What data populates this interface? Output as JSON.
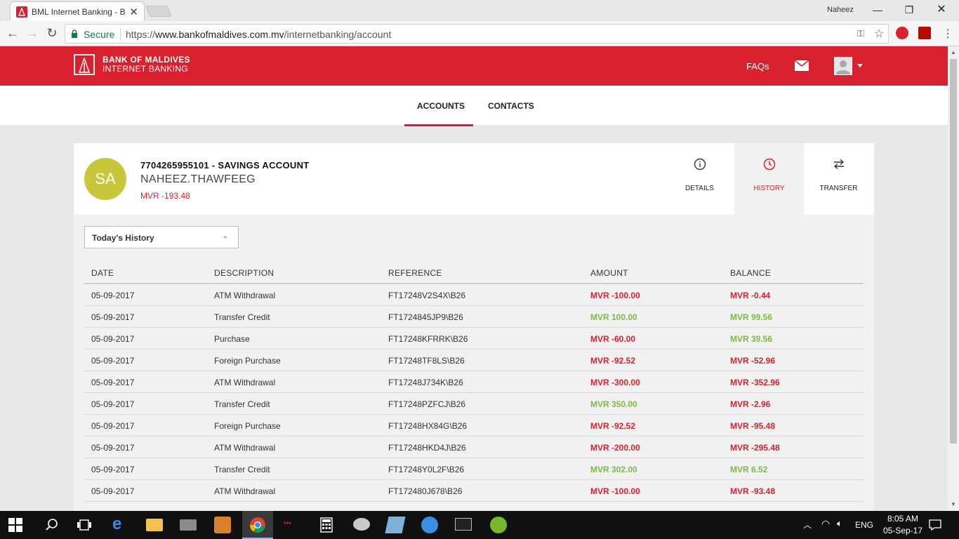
{
  "browser": {
    "tab_title": "BML Internet Banking - B",
    "user_name": "Naheez",
    "secure_label": "Secure",
    "url_prefix": "https://",
    "url_host": "www.bankofmaldives.com.mv",
    "url_path": "/internetbanking/account"
  },
  "header": {
    "brand_line1": "BANK OF MALDIVES",
    "brand_line2": "INTERNET BANKING",
    "faqs_label": "FAQs"
  },
  "nav": {
    "tabs": [
      {
        "label": "ACCOUNTS",
        "active": true
      },
      {
        "label": "CONTACTS",
        "active": false
      }
    ]
  },
  "account": {
    "initials": "SA",
    "title": "7704265955101 - SAVINGS ACCOUNT",
    "holder": "NAHEEZ.THAWFEEG",
    "balance": "MVR -193.48",
    "actions": [
      {
        "label": "DETAILS",
        "icon": "info-icon"
      },
      {
        "label": "HISTORY",
        "icon": "clock-icon",
        "active": true
      },
      {
        "label": "TRANSFER",
        "icon": "transfer-arrows-icon"
      }
    ]
  },
  "history": {
    "filter_selected": "Today's History",
    "columns": [
      "DATE",
      "DESCRIPTION",
      "REFERENCE",
      "AMOUNT",
      "BALANCE"
    ],
    "rows": [
      {
        "date": "05-09-2017",
        "description": "ATM Withdrawal",
        "reference": "FT17248V2S4X\\B26",
        "amount": "MVR -100.00",
        "amount_sign": "neg",
        "balance": "MVR -0.44",
        "balance_sign": "neg"
      },
      {
        "date": "05-09-2017",
        "description": "Transfer Credit",
        "reference": "FT1724845JP9\\B26",
        "amount": "MVR 100.00",
        "amount_sign": "pos",
        "balance": "MVR 99.56",
        "balance_sign": "pos"
      },
      {
        "date": "05-09-2017",
        "description": "Purchase",
        "reference": "FT17248KFRRK\\B26",
        "amount": "MVR -60.00",
        "amount_sign": "neg",
        "balance": "MVR 39.56",
        "balance_sign": "pos"
      },
      {
        "date": "05-09-2017",
        "description": "Foreign Purchase",
        "reference": "FT17248TF8LS\\B26",
        "amount": "MVR -92.52",
        "amount_sign": "neg",
        "balance": "MVR -52.96",
        "balance_sign": "neg"
      },
      {
        "date": "05-09-2017",
        "description": "ATM Withdrawal",
        "reference": "FT17248J734K\\B26",
        "amount": "MVR -300.00",
        "amount_sign": "neg",
        "balance": "MVR -352.96",
        "balance_sign": "neg"
      },
      {
        "date": "05-09-2017",
        "description": "Transfer Credit",
        "reference": "FT17248PZFCJ\\B26",
        "amount": "MVR 350.00",
        "amount_sign": "pos",
        "balance": "MVR -2.96",
        "balance_sign": "neg"
      },
      {
        "date": "05-09-2017",
        "description": "Foreign Purchase",
        "reference": "FT17248HX84G\\B26",
        "amount": "MVR -92.52",
        "amount_sign": "neg",
        "balance": "MVR -95.48",
        "balance_sign": "neg"
      },
      {
        "date": "05-09-2017",
        "description": "ATM Withdrawal",
        "reference": "FT17248HKD4J\\B26",
        "amount": "MVR -200.00",
        "amount_sign": "neg",
        "balance": "MVR -295.48",
        "balance_sign": "neg"
      },
      {
        "date": "05-09-2017",
        "description": "Transfer Credit",
        "reference": "FT17248Y0L2F\\B26",
        "amount": "MVR 302.00",
        "amount_sign": "pos",
        "balance": "MVR 6.52",
        "balance_sign": "pos"
      },
      {
        "date": "05-09-2017",
        "description": "ATM Withdrawal",
        "reference": "FT172480J678\\B26",
        "amount": "MVR -100.00",
        "amount_sign": "neg",
        "balance": "MVR -93.48",
        "balance_sign": "neg"
      }
    ]
  },
  "taskbar": {
    "language": "ENG",
    "time": "8:05 AM",
    "date": "05-Sep-17"
  },
  "colors": {
    "brand_red": "#d8202f",
    "positive_green": "#7cba45",
    "avatar_olive": "#c8c73b"
  }
}
